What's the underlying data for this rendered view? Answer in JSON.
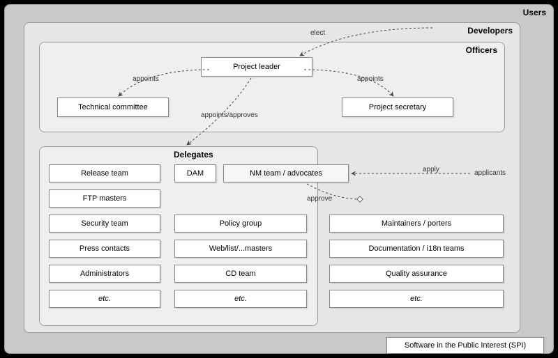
{
  "panels": {
    "users": "Users",
    "developers": "Developers",
    "officers": "Officers",
    "delegates": "Delegates"
  },
  "officers": {
    "project_leader": "Project leader",
    "technical_committee": "Technical committee",
    "project_secretary": "Project secretary"
  },
  "delegates": {
    "release_team": "Release team",
    "ftp_masters": "FTP masters",
    "security_team": "Security team",
    "press_contacts": "Press contacts",
    "administrators": "Administrators",
    "etc1": "etc.",
    "dam": "DAM",
    "nm_team": "NM team / advocates",
    "policy_group": "Policy group",
    "web_list": "Web/list/...masters",
    "cd_team": "CD team",
    "etc2": "etc."
  },
  "others": {
    "applicants": "applicants",
    "maintainers": "Maintainers / porters",
    "documentation": "Documentation / i18n teams",
    "quality": "Quality assurance",
    "etc3": "etc.",
    "spi": "Software in the Public Interest (SPI)"
  },
  "edges": {
    "elect": "elect",
    "appoints_left": "appoints",
    "appoints_right": "appoints",
    "appoints_approves": "appoints/approves",
    "apply": "apply",
    "approve": "approve"
  }
}
